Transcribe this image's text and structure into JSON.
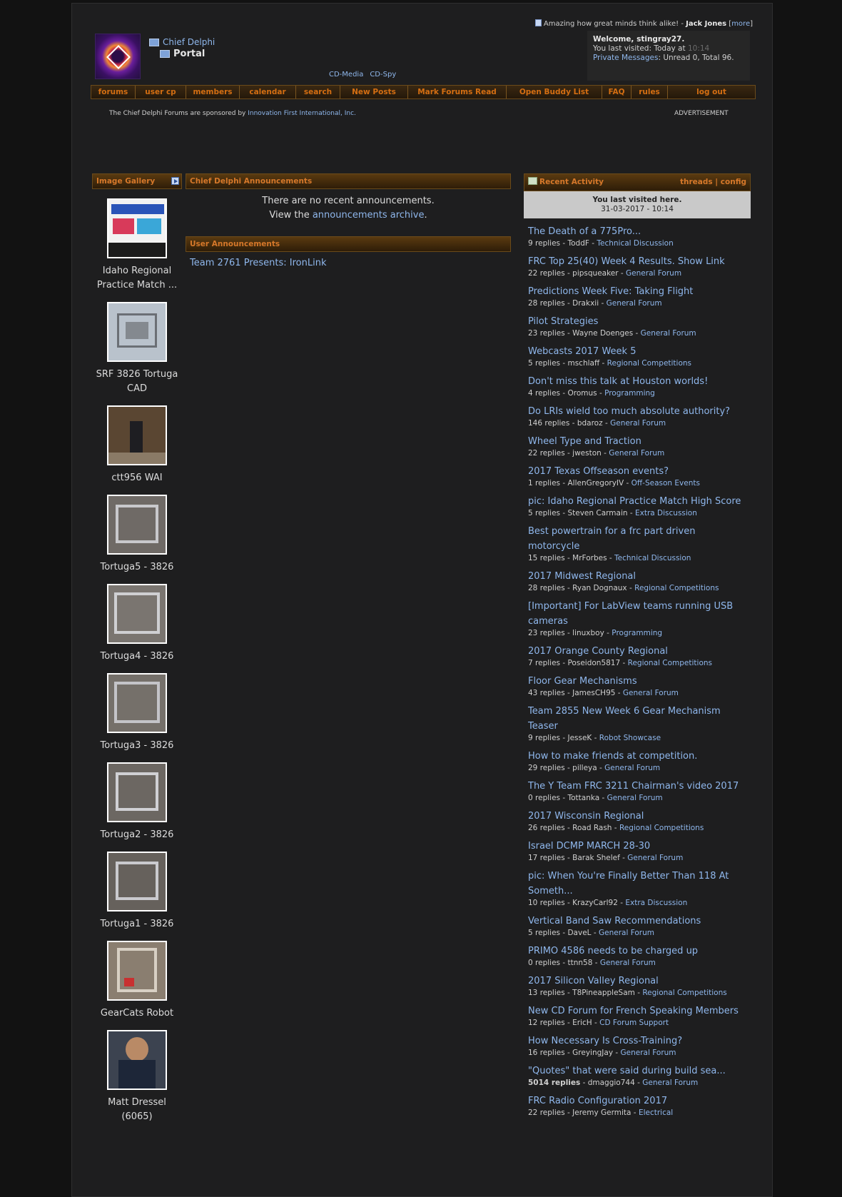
{
  "header": {
    "quote_text": "Amazing how great minds think alike! - ",
    "quote_author": "Jack Jones",
    "quote_more": "more",
    "site_name": "Chief Delphi",
    "portal": "Portal",
    "cd_media": "CD-Media",
    "cd_spy": "CD-Spy",
    "welcome_line": "Welcome, stingray27.",
    "last_visited_label": "You last visited: Today at ",
    "last_visited_time": "10:14",
    "pm_label": "Private Messages",
    "pm_status": ": Unread 0, Total 96."
  },
  "nav": [
    "forums",
    "user cp",
    "members",
    "calendar",
    "search",
    "New Posts",
    "Mark Forums Read",
    "Open Buddy List",
    "FAQ",
    "rules",
    "log out"
  ],
  "sponsor": {
    "text": "The Chief Delphi Forums are sponsored by ",
    "link": "Innovation First International, Inc.",
    "ad": "ADVERTISEMENT"
  },
  "gallery": {
    "title": "Image Gallery",
    "items": [
      {
        "caption": "Idaho Regional Practice Match ..."
      },
      {
        "caption": "SRF 3826 Tortuga CAD"
      },
      {
        "caption": "ctt956 WAI"
      },
      {
        "caption": "Tortuga5 - 3826"
      },
      {
        "caption": "Tortuga4 - 3826"
      },
      {
        "caption": "Tortuga3 - 3826"
      },
      {
        "caption": "Tortuga2 - 3826"
      },
      {
        "caption": "Tortuga1 - 3826"
      },
      {
        "caption": "GearCats Robot"
      },
      {
        "caption": "Matt Dressel (6065)"
      }
    ]
  },
  "announcements": {
    "title": "Chief Delphi Announcements",
    "none_text": "There are no recent announcements.",
    "view_prefix": "View the ",
    "archive_link": "announcements archive",
    "view_suffix": ".",
    "user_title": "User Announcements",
    "user_link": "Team 2761 Presents: IronLink"
  },
  "recent": {
    "title": "Recent Activity",
    "threads_link": "threads",
    "config_link": "config",
    "last_visit_label": "You last visited here.",
    "last_visit_date": "31-03-2017 - 10:14",
    "threads": [
      {
        "title": "The Death of a 775Pro...",
        "replies": "9 replies",
        "user": "ToddF",
        "forum": "Technical Discussion"
      },
      {
        "title": "FRC Top 25(40) Week 4 Results. Show Link",
        "replies": "22 replies",
        "user": "pipsqueaker",
        "forum": "General Forum"
      },
      {
        "title": "Predictions Week Five: Taking Flight",
        "replies": "28 replies",
        "user": "Drakxii",
        "forum": "General Forum"
      },
      {
        "title": "Pilot Strategies",
        "replies": "23 replies",
        "user": "Wayne Doenges",
        "forum": "General Forum"
      },
      {
        "title": "Webcasts 2017 Week 5",
        "replies": "5 replies",
        "user": "mschlaff",
        "forum": "Regional Competitions"
      },
      {
        "title": "Don't miss this talk at Houston worlds!",
        "replies": "4 replies",
        "user": "Oromus",
        "forum": "Programming"
      },
      {
        "title": "Do LRIs wield too much absolute authority?",
        "replies": "146 replies",
        "user": "bdaroz",
        "forum": "General Forum"
      },
      {
        "title": "Wheel Type and Traction",
        "replies": "22 replies",
        "user": "jweston",
        "forum": "General Forum"
      },
      {
        "title": "2017 Texas Offseason events?",
        "replies": "1 replies",
        "user": "AllenGregoryIV",
        "forum": "Off-Season Events"
      },
      {
        "title": "pic: Idaho Regional Practice Match High Score",
        "replies": "5 replies",
        "user": "Steven Carmain",
        "forum": "Extra Discussion"
      },
      {
        "title": "Best powertrain for a frc part driven motorcycle",
        "replies": "15 replies",
        "user": "MrForbes",
        "forum": "Technical Discussion"
      },
      {
        "title": "2017 Midwest Regional",
        "replies": "28 replies",
        "user": "Ryan Dognaux",
        "forum": "Regional Competitions"
      },
      {
        "title": "[Important] For LabView teams running USB cameras",
        "replies": "23 replies",
        "user": "linuxboy",
        "forum": "Programming"
      },
      {
        "title": "2017 Orange County Regional",
        "replies": "7 replies",
        "user": "Poseidon5817",
        "forum": "Regional Competitions"
      },
      {
        "title": "Floor Gear Mechanisms",
        "replies": "43 replies",
        "user": "JamesCH95",
        "forum": "General Forum"
      },
      {
        "title": "Team 2855 New Week 6 Gear Mechanism Teaser",
        "replies": "9 replies",
        "user": "JesseK",
        "forum": "Robot Showcase"
      },
      {
        "title": "How to make friends at competition.",
        "replies": "29 replies",
        "user": "pilleya",
        "forum": "General Forum"
      },
      {
        "title": "The Y Team FRC 3211 Chairman's video 2017",
        "replies": "0 replies",
        "user": "Tottanka",
        "forum": "General Forum"
      },
      {
        "title": "2017 Wisconsin Regional",
        "replies": "26 replies",
        "user": "Road Rash",
        "forum": "Regional Competitions"
      },
      {
        "title": "Israel DCMP MARCH 28-30",
        "replies": "17 replies",
        "user": "Barak Shelef",
        "forum": "General Forum"
      },
      {
        "title": "pic: When You're Finally Better Than 118 At Someth...",
        "replies": "10 replies",
        "user": "KrazyCarl92",
        "forum": "Extra Discussion"
      },
      {
        "title": "Vertical Band Saw Recommendations",
        "replies": "5 replies",
        "user": "DaveL",
        "forum": "General Forum"
      },
      {
        "title": "PRIMO 4586 needs to be charged up",
        "replies": "0 replies",
        "user": "ttnn58",
        "forum": "General Forum"
      },
      {
        "title": "2017 Silicon Valley Regional",
        "replies": "13 replies",
        "user": "T8PineappleSam",
        "forum": "Regional Competitions"
      },
      {
        "title": "New CD Forum for French Speaking Members",
        "replies": "12 replies",
        "user": "EricH",
        "forum": "CD Forum Support"
      },
      {
        "title": "How Necessary Is Cross-Training?",
        "replies": "16 replies",
        "user": "GreyingJay",
        "forum": "General Forum"
      },
      {
        "title": "\"Quotes\" that were said during build sea...",
        "replies": "5014 replies",
        "user": "dmaggio744",
        "forum": "General Forum"
      },
      {
        "title": "FRC Radio Configuration 2017",
        "replies": "22 replies",
        "user": "Jeremy Germita",
        "forum": "Electrical"
      }
    ]
  }
}
